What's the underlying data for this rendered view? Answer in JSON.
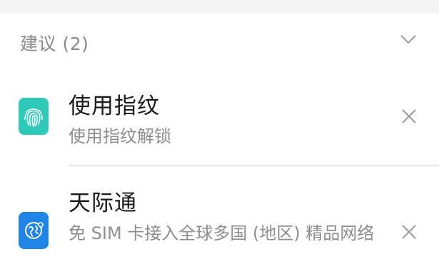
{
  "section": {
    "title": "建议 (2)",
    "collapse_icon": "chevron-down-icon"
  },
  "suggestions": [
    {
      "title": "使用指纹",
      "subtitle": "使用指纹解锁",
      "icon": "fingerprint-icon",
      "icon_color": "#2fc9b9",
      "dismiss_icon": "close-icon"
    },
    {
      "title": "天际通",
      "subtitle": "免 SIM 卡接入全球多国 (地区) 精品网络",
      "icon": "globe-icon",
      "icon_color": "#1f86e8",
      "dismiss_icon": "close-icon"
    }
  ]
}
